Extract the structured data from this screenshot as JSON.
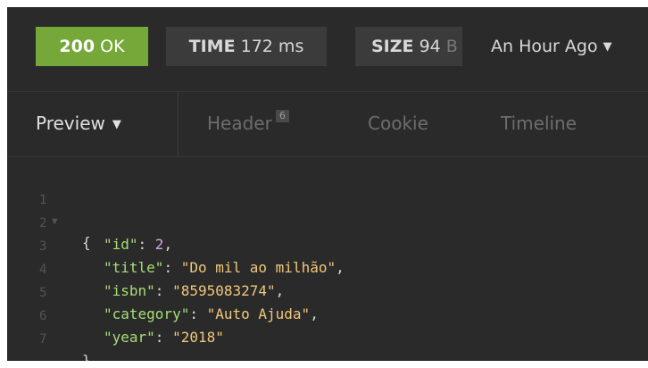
{
  "status_bar": {
    "status_code": "200",
    "status_text": "OK",
    "time_label": "TIME",
    "time_value": "172 ms",
    "size_label": "SIZE",
    "size_value": "94",
    "size_unit_clipped": "B",
    "history_label": "An Hour Ago"
  },
  "tabs": {
    "preview": "Preview",
    "header": "Header",
    "header_count": "6",
    "cookie": "Cookie",
    "timeline": "Timeline"
  },
  "code": {
    "line_numbers": [
      "1",
      "2",
      "3",
      "4",
      "5",
      "6",
      "7"
    ],
    "open_brace": "{",
    "close_brace": "}",
    "fields": [
      {
        "key": "\"id\"",
        "value": "2",
        "type": "number"
      },
      {
        "key": "\"title\"",
        "value": "\"Do mil ao milhão\"",
        "type": "string"
      },
      {
        "key": "\"isbn\"",
        "value": "\"8595083274\"",
        "type": "string"
      },
      {
        "key": "\"category\"",
        "value": "\"Auto Ajuda\"",
        "type": "string"
      },
      {
        "key": "\"year\"",
        "value": "\"2018\"",
        "type": "string"
      }
    ]
  },
  "colors": {
    "status_ok": "#75a839",
    "background": "#2a2a2a",
    "json_key": "#a7dd74",
    "json_string": "#f1c77a",
    "json_number": "#d3a6ef"
  },
  "icons": {
    "dropdown": "caret-down-icon",
    "fold": "fold-arrow-icon"
  }
}
